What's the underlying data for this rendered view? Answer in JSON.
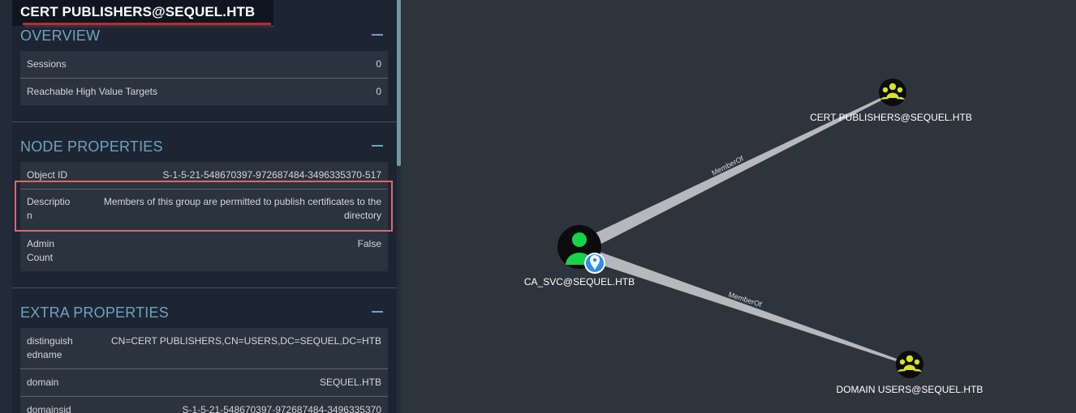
{
  "node_title": "CERT PUBLISHERS@SEQUEL.HTB",
  "sections": {
    "overview": "OVERVIEW",
    "node_properties": "NODE PROPERTIES",
    "extra_properties": "EXTRA PROPERTIES"
  },
  "overview": {
    "sessions_label": "Sessions",
    "sessions_value": "0",
    "reachable_label": "Reachable High Value Targets",
    "reachable_value": "0"
  },
  "node_properties": {
    "object_id_label": "Object ID",
    "object_id_value": "S-1-5-21-548670397-972687484-3496335370-517",
    "description_label": "Descriptio n",
    "description_value": "Members of this group are permitted to publish certificates to the directory",
    "admin_count_label": "Admin Count",
    "admin_count_value": "False"
  },
  "extra_properties": {
    "dn_label": "distinguish edname",
    "dn_value": "CN=CERT PUBLISHERS,CN=USERS,DC=SEQUEL,DC=HTB",
    "domain_label": "domain",
    "domain_value": "SEQUEL.HTB",
    "domainsid_label": "domainsid",
    "domainsid_value": "S-1-5-21-548670397-972687484-3496335370"
  },
  "graph": {
    "nodes": {
      "cert_publishers": "CERT PUBLISHERS@SEQUEL.HTB",
      "ca_svc": "CA_SVC@SEQUEL.HTB",
      "domain_users": "DOMAIN USERS@SEQUEL.HTB"
    },
    "edges": {
      "edge1": "MemberOf",
      "edge2": "MemberOf"
    },
    "icons": {
      "group": "group-icon",
      "user": "user-icon",
      "owned_marker": "map-pin-icon"
    },
    "colors": {
      "group_fill": "#d7e22a",
      "user_fill": "#16d348",
      "marker_fill": "#2d8ef0",
      "highlight_border": "#e06763",
      "accent": "#6fa3bd",
      "title_underline": "#c0282c"
    }
  }
}
